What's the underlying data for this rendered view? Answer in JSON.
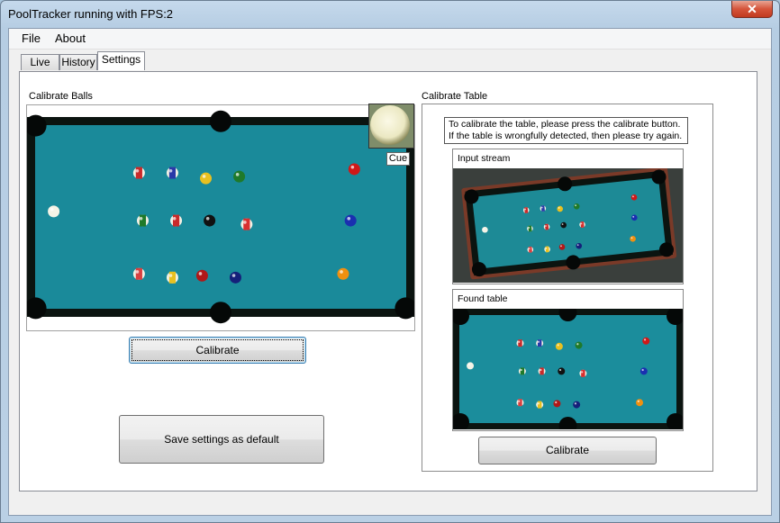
{
  "window": {
    "title": "PoolTracker running with FPS:2",
    "close_glyph": "✕"
  },
  "menu": {
    "items": [
      "File",
      "About"
    ]
  },
  "tabs": [
    {
      "label": "Live",
      "active": false
    },
    {
      "label": "History",
      "active": false
    },
    {
      "label": "Settings",
      "active": true
    }
  ],
  "calibrate_balls": {
    "title": "Calibrate Balls",
    "cue_label": "Cue",
    "calibrate_button": "Calibrate",
    "save_button": "Save settings as default"
  },
  "calibrate_table": {
    "title": "Calibrate Table",
    "instructions": [
      "To calibrate the table, please press the calibrate button.",
      "If the table is wrongfully detected, then please try again."
    ],
    "input_stream_label": "Input stream",
    "found_table_label": "Found table",
    "calibrate_button": "Calibrate"
  },
  "colors": {
    "felt": "#1a8a9a",
    "rail": "#0b1410",
    "window_frame": "#b9cfe4",
    "close_red": "#c7442b",
    "focus_blue": "#3c7fb1"
  },
  "icons": [
    "close-icon"
  ]
}
